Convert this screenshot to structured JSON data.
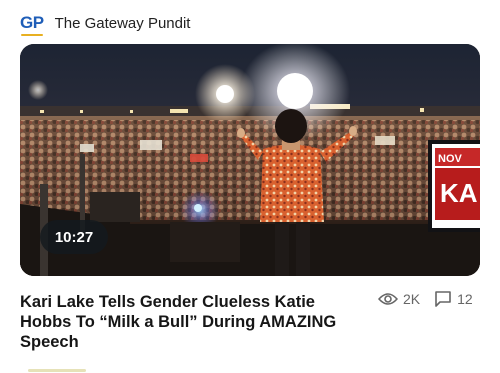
{
  "header": {
    "logo": "GP",
    "site_name": "The Gateway Pundit"
  },
  "video": {
    "duration": "10:27",
    "sign_text": "NOV",
    "sign_text_2": "KA"
  },
  "article": {
    "headline": "Kari Lake Tells Gender Clueless Katie Hobbs To “Milk a Bull” During AMAZING Speech",
    "views": "2K",
    "comments": "12"
  },
  "colors": {
    "brand_blue": "#1f5eb8",
    "brand_gold": "#e8b021",
    "meta_gray": "#666666"
  },
  "icons": {
    "views": "eye-icon",
    "comments": "comment-icon",
    "play_overlay": "none"
  }
}
